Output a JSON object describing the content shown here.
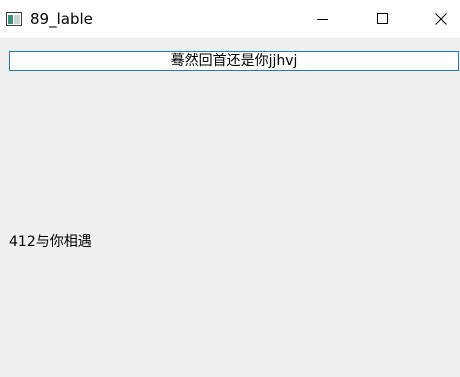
{
  "window": {
    "title": "89_lable",
    "icon": "app-window-icon",
    "controls": [
      "minimize-icon",
      "maximize-icon",
      "close-icon"
    ]
  },
  "content": {
    "top_label": "蓦然回首还是你jjhvj",
    "bottom_label": "412与你相遇"
  }
}
